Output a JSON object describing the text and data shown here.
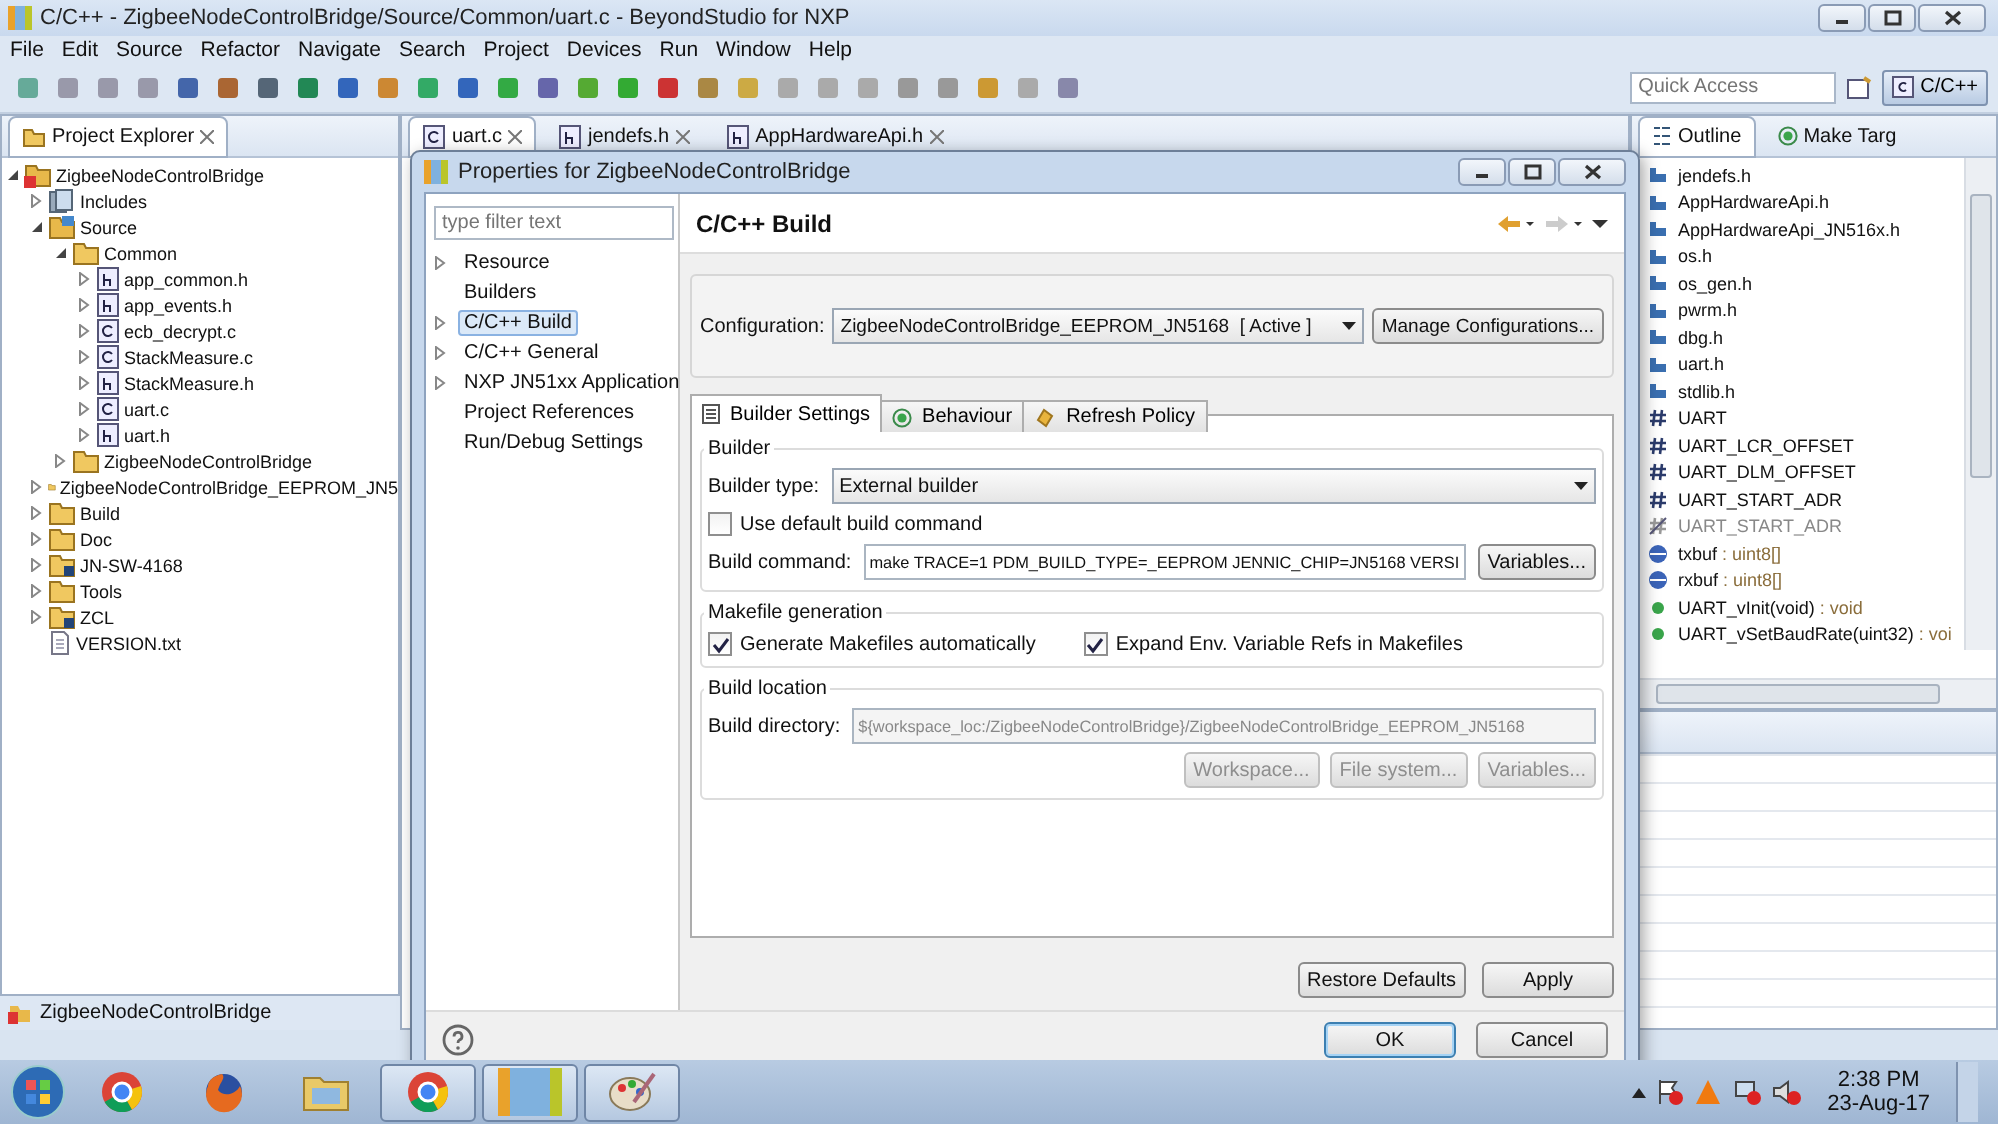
{
  "window": {
    "title": "C/C++ - ZigbeeNodeControlBridge/Source/Common/uart.c - BeyondStudio for NXP"
  },
  "menu": [
    "File",
    "Edit",
    "Source",
    "Refactor",
    "Navigate",
    "Search",
    "Project",
    "Devices",
    "Run",
    "Window",
    "Help"
  ],
  "toolbar": {
    "quick_access": {
      "placeholder": "Quick Access"
    },
    "perspective": {
      "label": "C/C++",
      "selected": true
    }
  },
  "project_explorer": {
    "title": "Project Explorer",
    "tree": [
      {
        "label": "ZigbeeNodeControlBridge",
        "kind": "project",
        "expanded": true,
        "children": [
          {
            "label": "Includes",
            "kind": "includes",
            "expanded": false
          },
          {
            "label": "Source",
            "kind": "source",
            "expanded": true,
            "children": [
              {
                "label": "Common",
                "kind": "folder",
                "expanded": true,
                "children": [
                  {
                    "label": "app_common.h",
                    "kind": "h_file",
                    "expanded": false
                  },
                  {
                    "label": "app_events.h",
                    "kind": "h_file",
                    "expanded": false
                  },
                  {
                    "label": "ecb_decrypt.c",
                    "kind": "c_file",
                    "expanded": false
                  },
                  {
                    "label": "StackMeasure.c",
                    "kind": "c_file",
                    "expanded": false
                  },
                  {
                    "label": "StackMeasure.h",
                    "kind": "h_file",
                    "expanded": false
                  },
                  {
                    "label": "uart.c",
                    "kind": "c_file",
                    "expanded": false
                  },
                  {
                    "label": "uart.h",
                    "kind": "h_file",
                    "expanded": false
                  }
                ]
              },
              {
                "label": "ZigbeeNodeControlBridge",
                "kind": "folder",
                "expanded": false
              }
            ]
          },
          {
            "label": "ZigbeeNodeControlBridge_EEPROM_JN5",
            "kind": "folder",
            "expanded": false
          },
          {
            "label": "Build",
            "kind": "folder",
            "expanded": false
          },
          {
            "label": "Doc",
            "kind": "folder",
            "expanded": false
          },
          {
            "label": "JN-SW-4168",
            "kind": "linked_folder",
            "expanded": false
          },
          {
            "label": "Tools",
            "kind": "folder",
            "expanded": false
          },
          {
            "label": "ZCL",
            "kind": "linked_folder",
            "expanded": false
          },
          {
            "label": "VERSION.txt",
            "kind": "text_file"
          }
        ]
      }
    ]
  },
  "editor_tabs": [
    {
      "label": "uart.c",
      "kind": "c_file",
      "selected": true
    },
    {
      "label": "jendefs.h",
      "kind": "h_file",
      "selected": false
    },
    {
      "label": "AppHardwareApi.h",
      "kind": "h_file",
      "selected": false
    }
  ],
  "outline": {
    "tabs": [
      {
        "label": "Outline",
        "selected": true
      },
      {
        "label": "Make Targ",
        "selected": false
      }
    ],
    "items": [
      {
        "kind": "include",
        "name": "jendefs.h"
      },
      {
        "kind": "include",
        "name": "AppHardwareApi.h"
      },
      {
        "kind": "include",
        "name": "AppHardwareApi_JN516x.h"
      },
      {
        "kind": "include",
        "name": "os.h"
      },
      {
        "kind": "include",
        "name": "os_gen.h"
      },
      {
        "kind": "include",
        "name": "pwrm.h"
      },
      {
        "kind": "include",
        "name": "dbg.h"
      },
      {
        "kind": "include",
        "name": "uart.h"
      },
      {
        "kind": "include",
        "name": "stdlib.h"
      },
      {
        "kind": "macro",
        "name": "UART"
      },
      {
        "kind": "macro",
        "name": "UART_LCR_OFFSET"
      },
      {
        "kind": "macro",
        "name": "UART_DLM_OFFSET"
      },
      {
        "kind": "macro",
        "name": "UART_START_ADR"
      },
      {
        "kind": "macro_inactive",
        "name": "UART_START_ADR"
      },
      {
        "kind": "variable",
        "name": "txbuf",
        "type": ": uint8[]"
      },
      {
        "kind": "variable",
        "name": "rxbuf",
        "type": ": uint8[]"
      },
      {
        "kind": "function",
        "name": "UART_vInit(void)",
        "type": ": void"
      },
      {
        "kind": "function",
        "name": "UART_vSetBaudRate(uint32)",
        "type": ": voi"
      }
    ]
  },
  "status_bar": {
    "text": "ZigbeeNodeControlBridge"
  },
  "dialog": {
    "title": "Properties for ZigbeeNodeControlBridge",
    "filter": {
      "placeholder": "type filter text"
    },
    "nav": [
      {
        "label": "Resource",
        "expandable": true,
        "selected": false
      },
      {
        "label": "Builders",
        "expandable": false,
        "selected": false
      },
      {
        "label": "C/C++ Build",
        "expandable": true,
        "selected": true
      },
      {
        "label": "C/C++ General",
        "expandable": true,
        "selected": false
      },
      {
        "label": "NXP JN51xx Application",
        "expandable": true,
        "selected": false
      },
      {
        "label": "Project References",
        "expandable": false,
        "selected": false
      },
      {
        "label": "Run/Debug Settings",
        "expandable": false,
        "selected": false
      }
    ],
    "page_title": "C/C++ Build",
    "configuration": {
      "label": "Configuration:",
      "value": "ZigbeeNodeControlBridge_EEPROM_JN5168  [ Active ]",
      "button": "Manage Configurations..."
    },
    "tabs": [
      {
        "label": "Builder Settings",
        "kind": "list",
        "selected": true
      },
      {
        "label": "Behaviour",
        "kind": "target",
        "selected": false
      },
      {
        "label": "Refresh Policy",
        "kind": "refresh",
        "selected": false
      }
    ],
    "builder": {
      "title": "Builder",
      "type_label": "Builder type:",
      "type_value": "External builder",
      "use_default": {
        "label": "Use default build command",
        "checked": false
      },
      "command_label": "Build command:",
      "command_value": "make TRACE=1 PDM_BUILD_TYPE=_EEPROM JENNIC_CHIP=JN5168 VERSI",
      "variables_button": "Variables..."
    },
    "makefile": {
      "title": "Makefile generation",
      "options": [
        {
          "label": "Generate Makefiles automatically",
          "checked": true
        },
        {
          "label": "Expand Env. Variable Refs in Makefiles",
          "checked": true
        }
      ]
    },
    "location": {
      "title": "Build location",
      "directory_label": "Build directory:",
      "directory_value": "${workspace_loc:/ZigbeeNodeControlBridge}/ZigbeeNodeControlBridge_EEPROM_JN5168",
      "disabled": true,
      "buttons": [
        "Workspace...",
        "File system...",
        "Variables..."
      ]
    },
    "page_buttons": [
      "Restore Defaults",
      "Apply"
    ],
    "buttons": [
      {
        "label": "OK",
        "kind": "default"
      },
      {
        "label": "Cancel",
        "kind": "normal"
      }
    ]
  },
  "taskbar": {
    "apps": [
      {
        "kind": "chrome",
        "selected": false
      },
      {
        "kind": "firefox",
        "selected": false
      },
      {
        "kind": "explorer",
        "selected": false
      },
      {
        "kind": "chrome",
        "selected": true
      },
      {
        "kind": "studio",
        "selected": true
      },
      {
        "kind": "paint",
        "selected": true
      }
    ],
    "time": "2:38 PM",
    "date": "23-Aug-17"
  }
}
